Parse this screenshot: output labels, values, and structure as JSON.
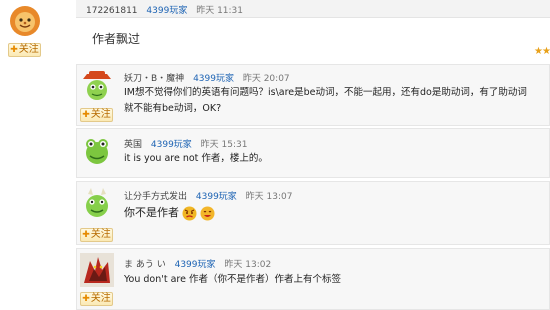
{
  "header": {
    "user_id": "172261811",
    "badge": "4399玩家",
    "time": "昨天 11:31"
  },
  "post": {
    "text": "作者飘过",
    "follow_label": "关注"
  },
  "replies": [
    {
      "username": "妖刀・B・魔神",
      "badge": "4399玩家",
      "time": "昨天 20:07",
      "lines": [
        "IM想不觉得你们的英语有问题吗？is\\are是be动词，不能一起用，还有do是助动词，有了助动词",
        "就不能有be动词，OK?"
      ],
      "follow_label": "关注"
    },
    {
      "username": "英国",
      "badge": "4399玩家",
      "time": "昨天 15:31",
      "lines": [
        "it is you are not 作者，楼上的。"
      ]
    },
    {
      "username": "让分手方式发出",
      "badge": "4399玩家",
      "time": "昨天 13:07",
      "lines": [
        "你不是作者"
      ],
      "follow_label": "关注"
    },
    {
      "username": "ま あう い",
      "badge": "4399玩家",
      "time": "昨天 13:02",
      "lines": [
        "You don't are 作者（你不是作者）作者上有个标签"
      ],
      "follow_label": "关注"
    }
  ],
  "colors": {
    "badge_blue": "#1e64b4",
    "follow_text": "#b66a00",
    "card_bg": "#f7f7f7"
  },
  "icons": [
    "lion-avatar",
    "cowboy-frog-avatar",
    "green-frog-avatar",
    "horned-frog-avatar",
    "dragon-avatar",
    "angry-emoji",
    "grin-emoji",
    "star-rating-icon"
  ]
}
